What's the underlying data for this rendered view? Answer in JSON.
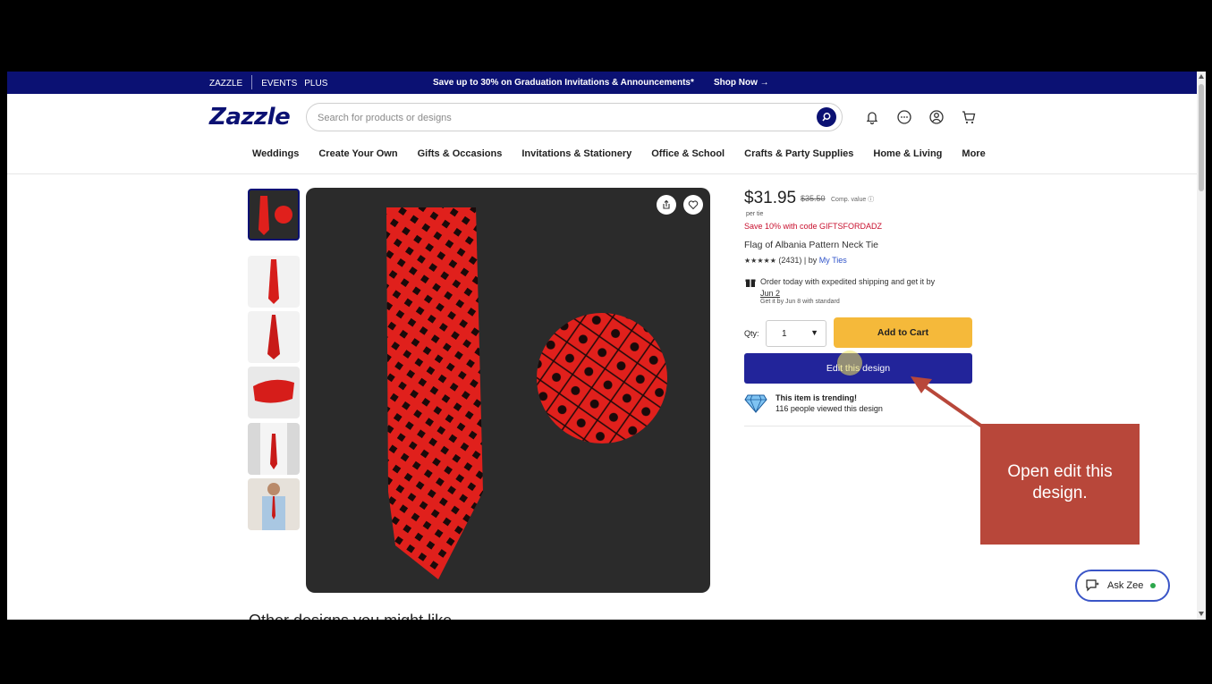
{
  "promo_bar": {
    "brand": "ZAZZLE",
    "events": "EVENTS",
    "plus": "PLUS",
    "message": "Save up to 30% on Graduation Invitations & Announcements*",
    "shop_now": "Shop Now →"
  },
  "header": {
    "logo": "Zazzle",
    "search_placeholder": "Search for products or designs",
    "icons": [
      "bell-icon",
      "chat-icon",
      "account-icon",
      "cart-icon"
    ]
  },
  "nav": {
    "items": [
      "Weddings",
      "Create Your Own",
      "Gifts & Occasions",
      "Invitations & Stationery",
      "Office & School",
      "Crafts & Party Supplies",
      "Home & Living",
      "More"
    ]
  },
  "product": {
    "price": "$31.95",
    "old_price": "$35.50",
    "comp_value": "Comp. value",
    "per_unit": "per tie",
    "promo": "Save 10% with code GIFTSFORDADZ",
    "title": "Flag of Albania Pattern Neck Tie",
    "stars": "★★★★★",
    "reviews": "(2431)",
    "by": "| by",
    "seller": "My Ties",
    "shipping_line1": "Order today with expedited shipping and get it by",
    "shipping_date": "Jun 2",
    "shipping_standard": "Get it by Jun 8 with standard",
    "qty_label": "Qty:",
    "qty_value": "1",
    "add_to_cart": "Add to Cart",
    "edit_design": "Edit this design",
    "trending_title": "This item is trending!",
    "trending_text": "116 people viewed this design"
  },
  "annotation": {
    "text": "Open edit this design."
  },
  "ask_zee": "Ask Zee",
  "more_heading": "Other designs you might like",
  "colors": {
    "brand_navy": "#0b1173",
    "tie_red": "#e0201c",
    "add_to_cart": "#f5b93a",
    "edit_button": "#22249a",
    "callout": "#b8473a"
  }
}
